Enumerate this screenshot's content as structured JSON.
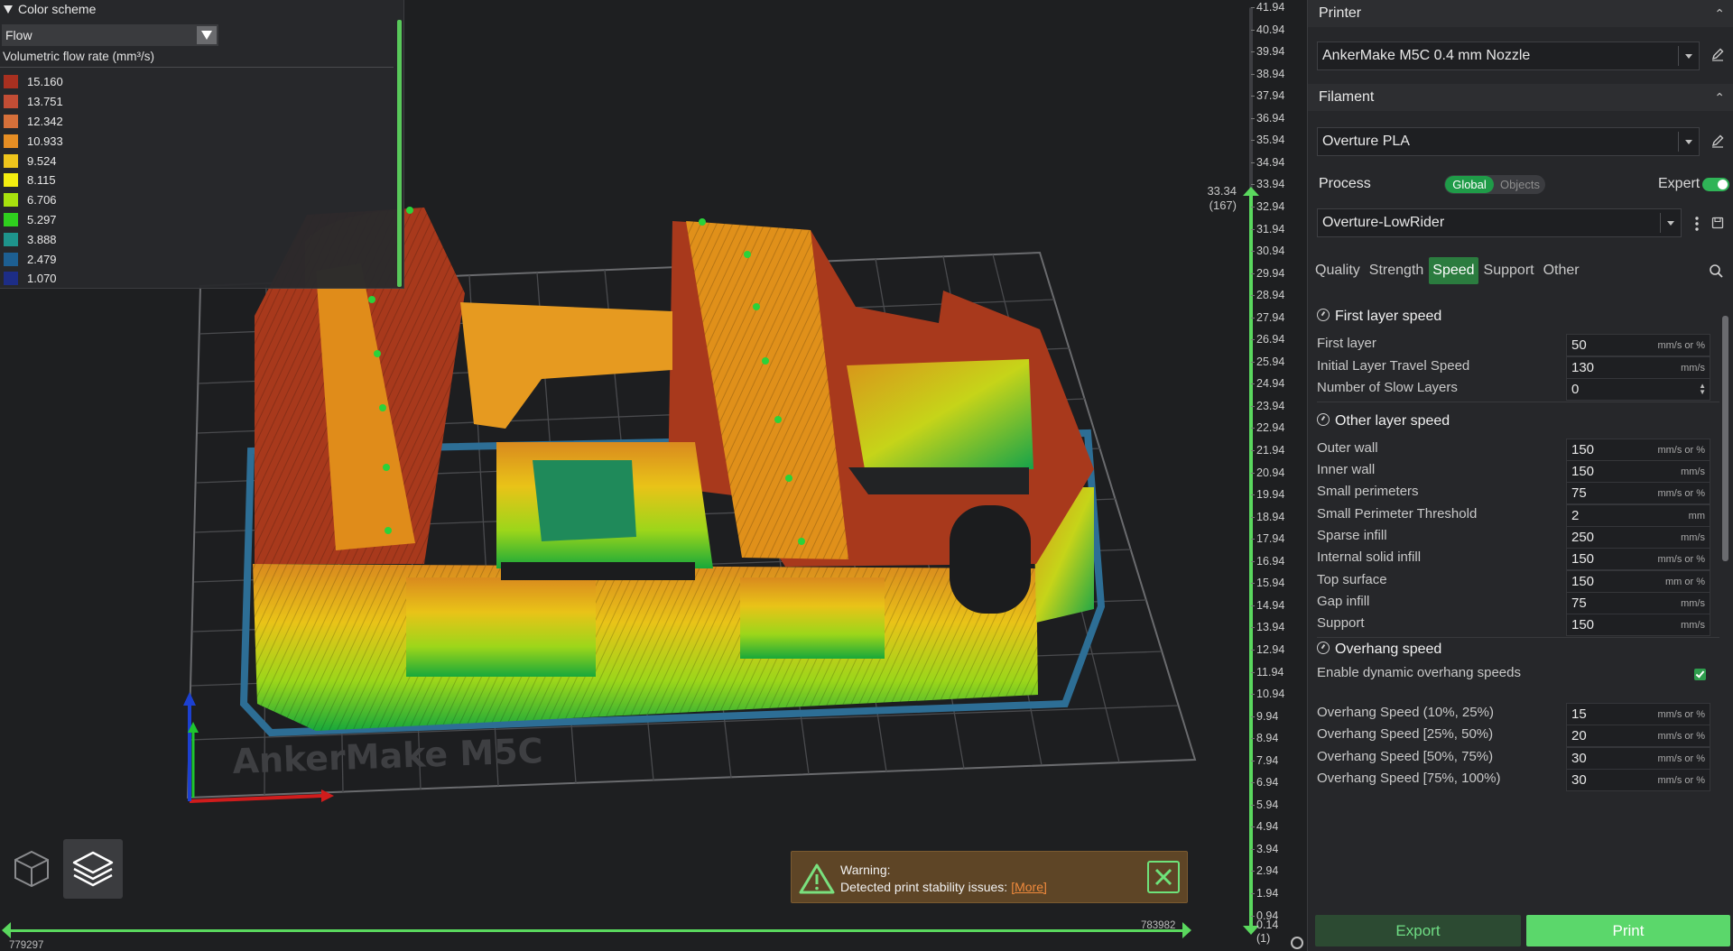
{
  "legend": {
    "header": "Color scheme",
    "scheme": "Flow",
    "title": "Volumetric flow rate (mm³/s)",
    "items": [
      {
        "value": "15.160",
        "color": "#a83020"
      },
      {
        "value": "13.751",
        "color": "#c24d35"
      },
      {
        "value": "12.342",
        "color": "#d6703a"
      },
      {
        "value": "10.933",
        "color": "#e68e24"
      },
      {
        "value": "9.524",
        "color": "#efc51c"
      },
      {
        "value": "8.115",
        "color": "#f4ee10"
      },
      {
        "value": "6.706",
        "color": "#a8e20e"
      },
      {
        "value": "5.297",
        "color": "#2fcf1e"
      },
      {
        "value": "3.888",
        "color": "#1e948c"
      },
      {
        "value": "2.479",
        "color": "#1d5f92"
      },
      {
        "value": "1.070",
        "color": "#1d2d86"
      }
    ]
  },
  "viewport": {
    "bed_label": "AnkerMake  M5C",
    "view_buttons": {
      "three_d": "cube-icon",
      "preview": "layers-icon"
    }
  },
  "warning": {
    "title": "Warning:",
    "message": "Detected print stability issues:",
    "link": "[More]"
  },
  "move_slider": {
    "min": "779297",
    "max": "783982"
  },
  "layer_slider": {
    "current_height": "33.34",
    "current_layer": "(167)",
    "ticks": [
      "41.94",
      "40.94",
      "39.94",
      "38.94",
      "37.94",
      "36.94",
      "35.94",
      "34.94",
      "33.94",
      "32.94",
      "31.94",
      "30.94",
      "29.94",
      "28.94",
      "27.94",
      "26.94",
      "25.94",
      "24.94",
      "23.94",
      "22.94",
      "21.94",
      "20.94",
      "19.94",
      "18.94",
      "17.94",
      "16.94",
      "15.94",
      "14.94",
      "13.94",
      "12.94",
      "11.94",
      "10.94",
      "9.94",
      "8.94",
      "7.94",
      "6.94",
      "5.94",
      "4.94",
      "3.94",
      "2.94",
      "1.94",
      "0.94"
    ],
    "bottom_height": "0.14",
    "bottom_layer": "(1)"
  },
  "sidebar": {
    "printer": {
      "header": "Printer",
      "value": "AnkerMake M5C 0.4 mm Nozzle"
    },
    "filament": {
      "header": "Filament",
      "value": "Overture PLA"
    },
    "process": {
      "header": "Process",
      "scope_global": "Global",
      "scope_objects": "Objects",
      "expert": "Expert",
      "preset": "Overture-LowRider"
    },
    "tabs": [
      "Quality",
      "Strength",
      "Speed",
      "Support",
      "Other"
    ],
    "active_tab": "Speed",
    "groups": {
      "first_layer": "First layer speed",
      "other_layer": "Other layer speed",
      "overhang": "Overhang speed"
    },
    "settings": [
      {
        "label": "First layer",
        "value": "50",
        "unit": "mm/s or %"
      },
      {
        "label": "Initial Layer Travel Speed",
        "value": "130",
        "unit": "mm/s"
      },
      {
        "label": "Number of Slow Layers",
        "value": "0",
        "unit": ""
      },
      {
        "label": "Outer wall",
        "value": "150",
        "unit": "mm/s or %"
      },
      {
        "label": "Inner wall",
        "value": "150",
        "unit": "mm/s"
      },
      {
        "label": "Small perimeters",
        "value": "75",
        "unit": "mm/s or %"
      },
      {
        "label": "Small Perimeter Threshold",
        "value": "2",
        "unit": "mm"
      },
      {
        "label": "Sparse infill",
        "value": "250",
        "unit": "mm/s"
      },
      {
        "label": "Internal solid infill",
        "value": "150",
        "unit": "mm/s or %"
      },
      {
        "label": "Top surface",
        "value": "150",
        "unit": "mm or %"
      },
      {
        "label": "Gap infill",
        "value": "75",
        "unit": "mm/s"
      },
      {
        "label": "Support",
        "value": "150",
        "unit": "mm/s"
      },
      {
        "label": "Enable dynamic overhang speeds",
        "value": "",
        "unit": ""
      },
      {
        "label": "Overhang Speed (10%, 25%)",
        "value": "15",
        "unit": "mm/s or %"
      },
      {
        "label": "Overhang Speed [25%, 50%)",
        "value": "20",
        "unit": "mm/s or %"
      },
      {
        "label": "Overhang Speed [50%, 75%)",
        "value": "30",
        "unit": "mm/s or %"
      },
      {
        "label": "Overhang Speed [75%, 100%)",
        "value": "30",
        "unit": "mm/s or %"
      }
    ],
    "dynamic_overhang_enabled": true,
    "export_label": "Export",
    "print_label": "Print"
  },
  "colors": {
    "accent": "#5ad85e",
    "brand_green": "#1f9b48",
    "warning_bg": "#5e4526"
  }
}
